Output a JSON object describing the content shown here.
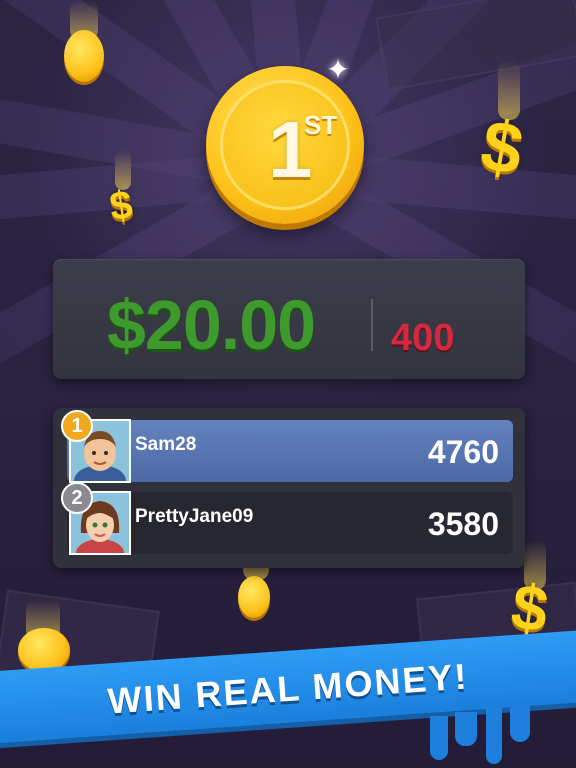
{
  "hero": {
    "rank_number": "1",
    "rank_suffix": "ST"
  },
  "prize": {
    "amount": "$20.00",
    "points": "400"
  },
  "leaderboard": {
    "rows": [
      {
        "rank": "1",
        "name": "Sam28",
        "score": "4760"
      },
      {
        "rank": "2",
        "name": "PrettyJane09",
        "score": "3580"
      }
    ]
  },
  "banner": {
    "text": "WIN REAL MONEY!"
  },
  "decor": {
    "dollar_symbol": "$",
    "colors": {
      "coin_gold": "#ffc21a",
      "prize_green": "#3f9a2d",
      "points_red": "#d6283e",
      "highlight_row": "#5877b4",
      "banner_blue": "#1f87e2"
    }
  }
}
